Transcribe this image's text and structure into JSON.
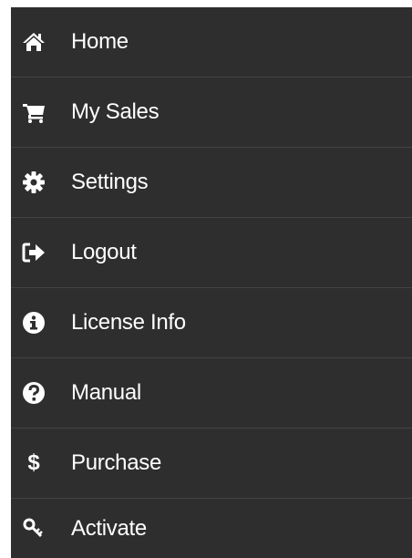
{
  "menu": {
    "items": [
      {
        "label": "Home",
        "icon": "home-icon"
      },
      {
        "label": "My Sales",
        "icon": "cart-icon"
      },
      {
        "label": "Settings",
        "icon": "gear-icon"
      },
      {
        "label": "Logout",
        "icon": "logout-icon"
      },
      {
        "label": "License Info",
        "icon": "info-icon"
      },
      {
        "label": "Manual",
        "icon": "question-icon"
      },
      {
        "label": "Purchase",
        "icon": "dollar-icon",
        "glyph": "$"
      },
      {
        "label": "Activate",
        "icon": "key-icon"
      }
    ]
  },
  "colors": {
    "background": "#2f2e2e",
    "divider": "#444343",
    "text": "#ffffff"
  }
}
